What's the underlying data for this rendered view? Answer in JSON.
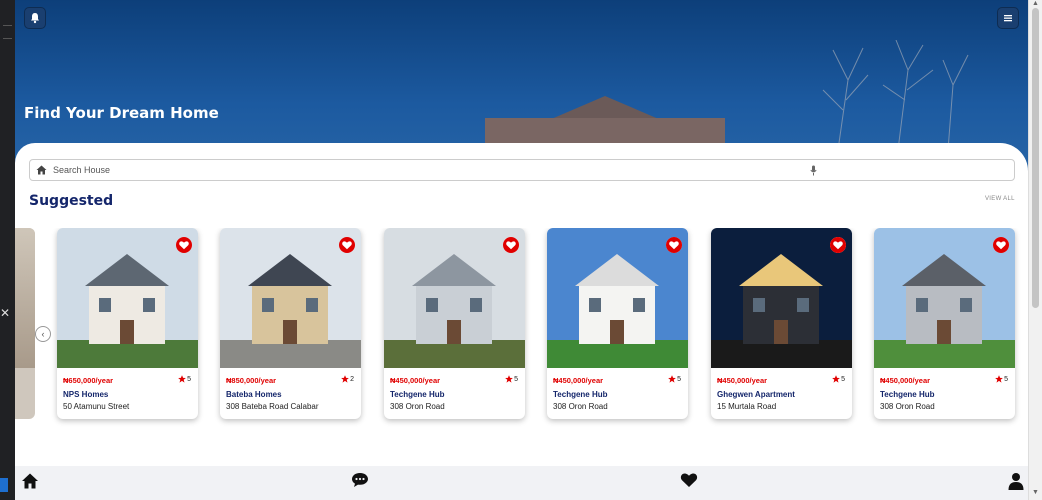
{
  "hero": {
    "title": "Find Your Dream Home"
  },
  "search": {
    "placeholder": "Search House"
  },
  "section": {
    "title": "Suggested",
    "view_all": "VIEW ALL"
  },
  "colors": {
    "brand": "#14266b",
    "price": "#e00000",
    "heart": "#e00000",
    "hero": "#1c5aa0"
  },
  "listings": [
    {
      "price": "₦650,000/year",
      "rating": "5",
      "name": "NPS Homes",
      "address": "50 Atamunu Street"
    },
    {
      "price": "₦850,000/year",
      "rating": "2",
      "name": "Bateba Homes",
      "address": "308 Bateba Road Calabar"
    },
    {
      "price": "₦450,000/year",
      "rating": "5",
      "name": "Techgene Hub",
      "address": "308 Oron Road"
    },
    {
      "price": "₦450,000/year",
      "rating": "5",
      "name": "Techgene Hub",
      "address": "308 Oron Road"
    },
    {
      "price": "₦450,000/year",
      "rating": "5",
      "name": "Ghegwen Apartment",
      "address": "15 Murtala Road"
    },
    {
      "price": "₦450,000/year",
      "rating": "5",
      "name": "Techgene Hub",
      "address": "308 Oron Road"
    }
  ],
  "icons": {
    "notifications": "bell-icon",
    "menu": "menu-icon",
    "search": "home-icon",
    "voice": "mic-icon",
    "favorite": "heart-icon",
    "rating": "star-icon",
    "previous": "chevron-left-icon",
    "nav": [
      "home-icon",
      "chat-icon",
      "heart-icon",
      "user-icon"
    ]
  }
}
